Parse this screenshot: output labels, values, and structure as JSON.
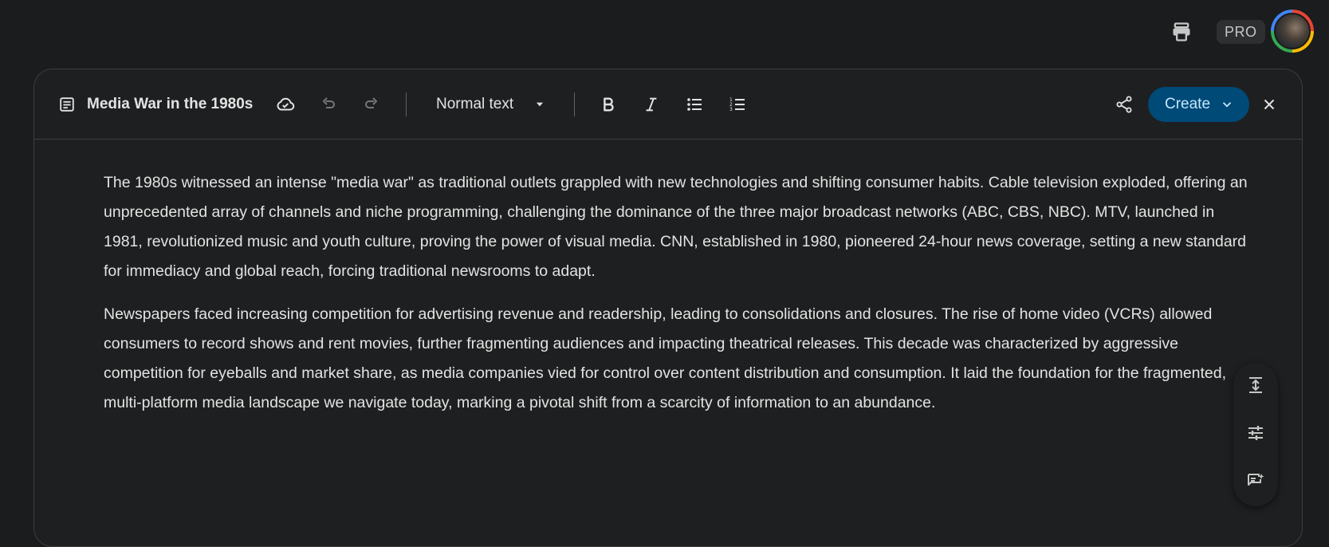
{
  "topbar": {
    "pro_label": "PRO",
    "icons": [
      "printer-icon",
      "avatar"
    ]
  },
  "editor": {
    "title": "Media War in the 1980s",
    "text_style": "Normal text",
    "create_label": "Create",
    "toolbar_icons": [
      "document-icon",
      "cloud-sync-icon",
      "undo-icon",
      "redo-icon",
      "bold-icon",
      "italic-icon",
      "bulleted-list-icon",
      "numbered-list-icon",
      "share-icon",
      "close-icon"
    ],
    "paragraphs": [
      "The 1980s witnessed an intense \"media war\" as traditional outlets grappled with new technologies and shifting consumer habits. Cable television exploded, offering an unprecedented array of channels and niche programming, challenging the dominance of the three major broadcast networks (ABC, CBS, NBC). MTV, launched in 1981, revolutionized music and youth culture, proving the power of visual media. CNN, established in 1980, pioneered 24-hour news coverage, setting a new standard for immediacy and global reach, forcing traditional newsrooms to adapt.",
      "Newspapers faced increasing competition for advertising revenue and readership, leading to consolidations and closures. The rise of home video (VCRs) allowed consumers to record shows and rent movies, further fragmenting audiences and impacting theatrical releases. This decade was characterized by aggressive competition for eyeballs and market share, as media companies vied for control over content distribution and consumption. It laid the foundation for the fragmented, multi-platform media landscape we navigate today, marking a pivotal shift from a scarcity of information to an abundance."
    ],
    "side_tools": [
      "expand-length-icon",
      "tune-icon",
      "add-note-icon"
    ]
  },
  "colors": {
    "background": "#1b1c1d",
    "surface": "#1e1f20",
    "create_button": "#004a77",
    "create_text": "#c2e7ff"
  }
}
